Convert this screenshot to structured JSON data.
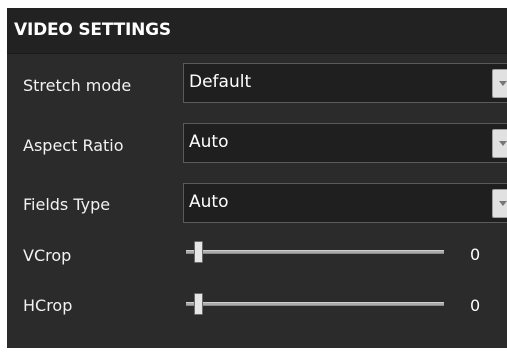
{
  "panel": {
    "title": "VIDEO SETTINGS"
  },
  "rows": {
    "stretch_mode": {
      "label": "Stretch mode",
      "value": "Default"
    },
    "aspect_ratio": {
      "label": "Aspect Ratio",
      "value": "Auto"
    },
    "fields_type": {
      "label": "Fields Type",
      "value": "Auto"
    },
    "vcrop": {
      "label": "VCrop",
      "value": "0",
      "level": 0
    },
    "hcrop": {
      "label": "HCrop",
      "value": "0",
      "level": 0
    }
  },
  "icons": {
    "dropdown": "chevron-down-icon"
  },
  "colors": {
    "panel_bg": "#2b2b2b",
    "header_bg": "#222222",
    "input_bg": "#1f1f1f",
    "text": "#ffffff"
  }
}
